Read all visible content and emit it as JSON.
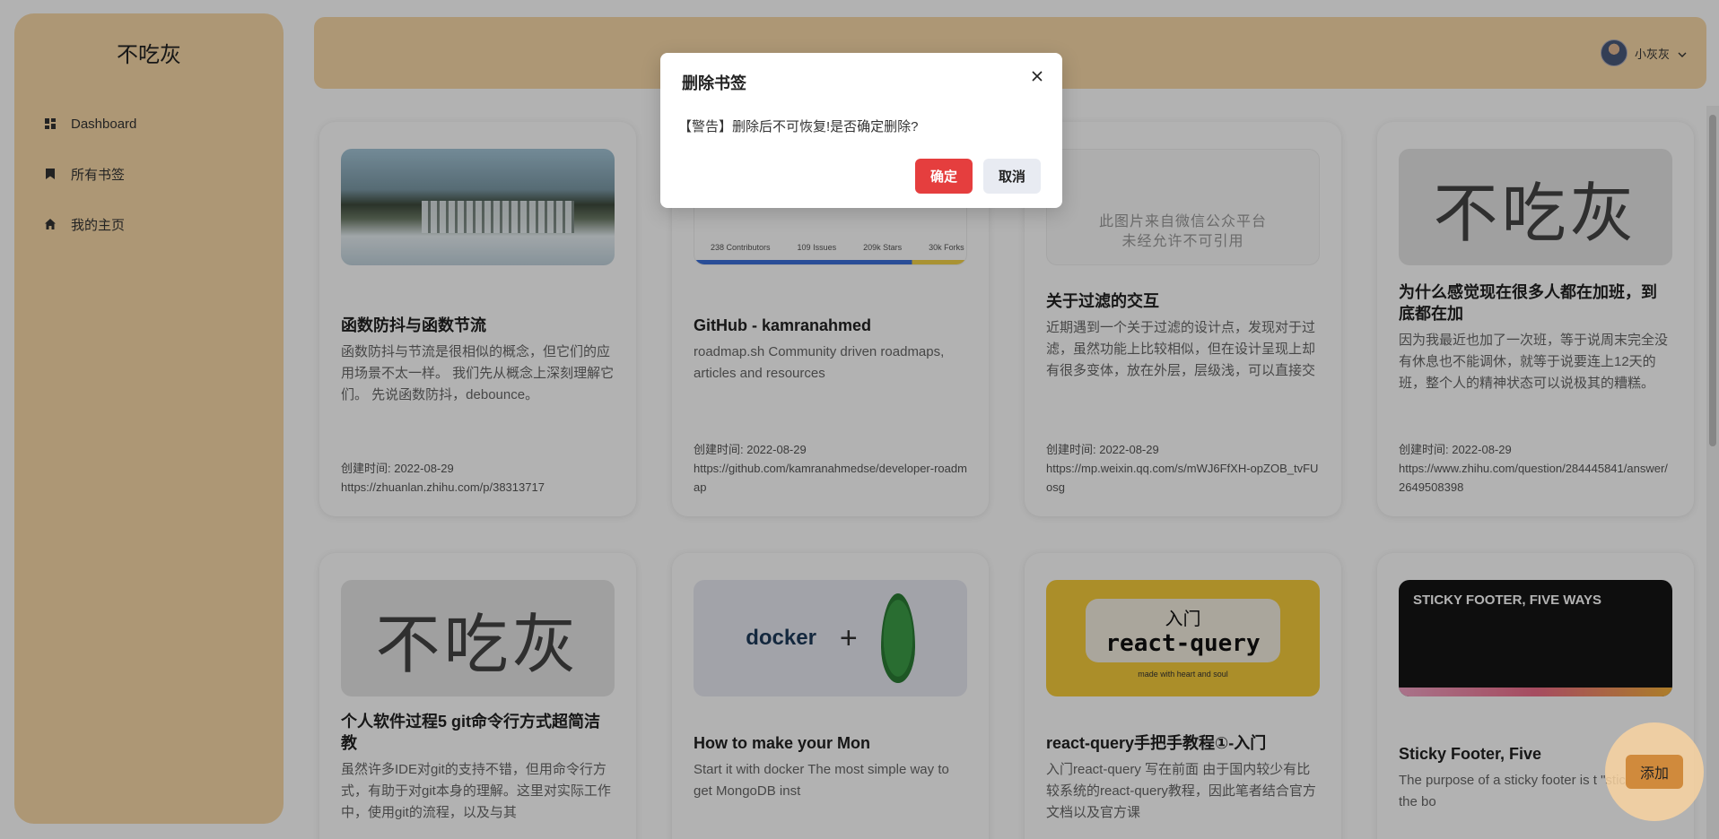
{
  "sidebar": {
    "logo": "不吃灰",
    "items": [
      {
        "label": "Dashboard",
        "icon": "dashboard-icon"
      },
      {
        "label": "所有书签",
        "icon": "bookmark-icon"
      },
      {
        "label": "我的主页",
        "icon": "home-icon"
      }
    ]
  },
  "header": {
    "user_name": "小灰灰"
  },
  "cards": [
    {
      "title": "函数防抖与函数节流",
      "desc": "函数防抖与节流是很相似的概念，但它们的应用场景不太一样。 我们先从概念上深刻理解它们。 先说函数防抖，debounce。",
      "created": "创建时间: 2022-08-29",
      "url": "https://zhuanlan.zhihu.com/p/38313717"
    },
    {
      "title": "GitHub - kamranahmed",
      "desc": "roadmap.sh Community driven roadmaps, articles and resources",
      "created": "创建时间: 2022-08-29",
      "url": "https://github.com/kamranahmedse/developer-roadmap",
      "thumb_stats": [
        "238 Contributors",
        "109 Issues",
        "209k Stars",
        "30k Forks"
      ]
    },
    {
      "title": "关于过滤的交互",
      "desc": "近期遇到一个关于过滤的设计点，发现对于过滤，虽然功能上比较相似，但在设计呈现上却有很多变体，放在外层，层级浅，可以直接交",
      "created": "创建时间: 2022-08-29",
      "url": "https://mp.weixin.qq.com/s/mWJ6FfXH-opZOB_tvFUosg",
      "thumb_text": "此图片来自微信公众平台\n未经允许不可引用"
    },
    {
      "title": "为什么感觉现在很多人都在加班，到底都在加",
      "desc": "因为我最近也加了一次班，等于说周末完全没有休息也不能调休，就等于说要连上12天的班，整个人的精神状态可以说极其的糟糕。",
      "created": "创建时间: 2022-08-29",
      "url": "https://www.zhihu.com/question/284445841/answer/2649508398",
      "thumb_text": "不吃灰"
    },
    {
      "title": "个人软件过程5 git命令行方式超简洁教",
      "desc": "虽然许多IDE对git的支持不错，但用命令行方式，有助于对git本身的理解。这里对实际工作中，使用git的流程，以及与其",
      "thumb_text": "不吃灰"
    },
    {
      "title": "How to make your Mon",
      "desc": "Start it with docker The most simple way to get MongoDB inst",
      "thumb_text": "docker"
    },
    {
      "title": "react-query手把手教程①-入门",
      "desc": "入门react-query 写在前面 由于国内较少有比较系统的react-query教程，因此笔者结合官方文档以及官方课",
      "thumb_top": "入门",
      "thumb_main": "react-query",
      "thumb_small": "made with heart and soul"
    },
    {
      "title": "Sticky Footer, Five",
      "desc": "The purpose of a sticky footer is t \"sticks\" to the bo",
      "thumb_text": "STICKY FOOTER, FIVE WAYS"
    }
  ],
  "modal": {
    "title": "删除书签",
    "body": "【警告】删除后不可恢复!是否确定删除?",
    "ok": "确定",
    "cancel": "取消"
  },
  "fab": {
    "label": "添加"
  },
  "colors": {
    "sidebar_bg": "#f8d9a8",
    "danger": "#e53e3e",
    "accent": "#d08a3c"
  }
}
